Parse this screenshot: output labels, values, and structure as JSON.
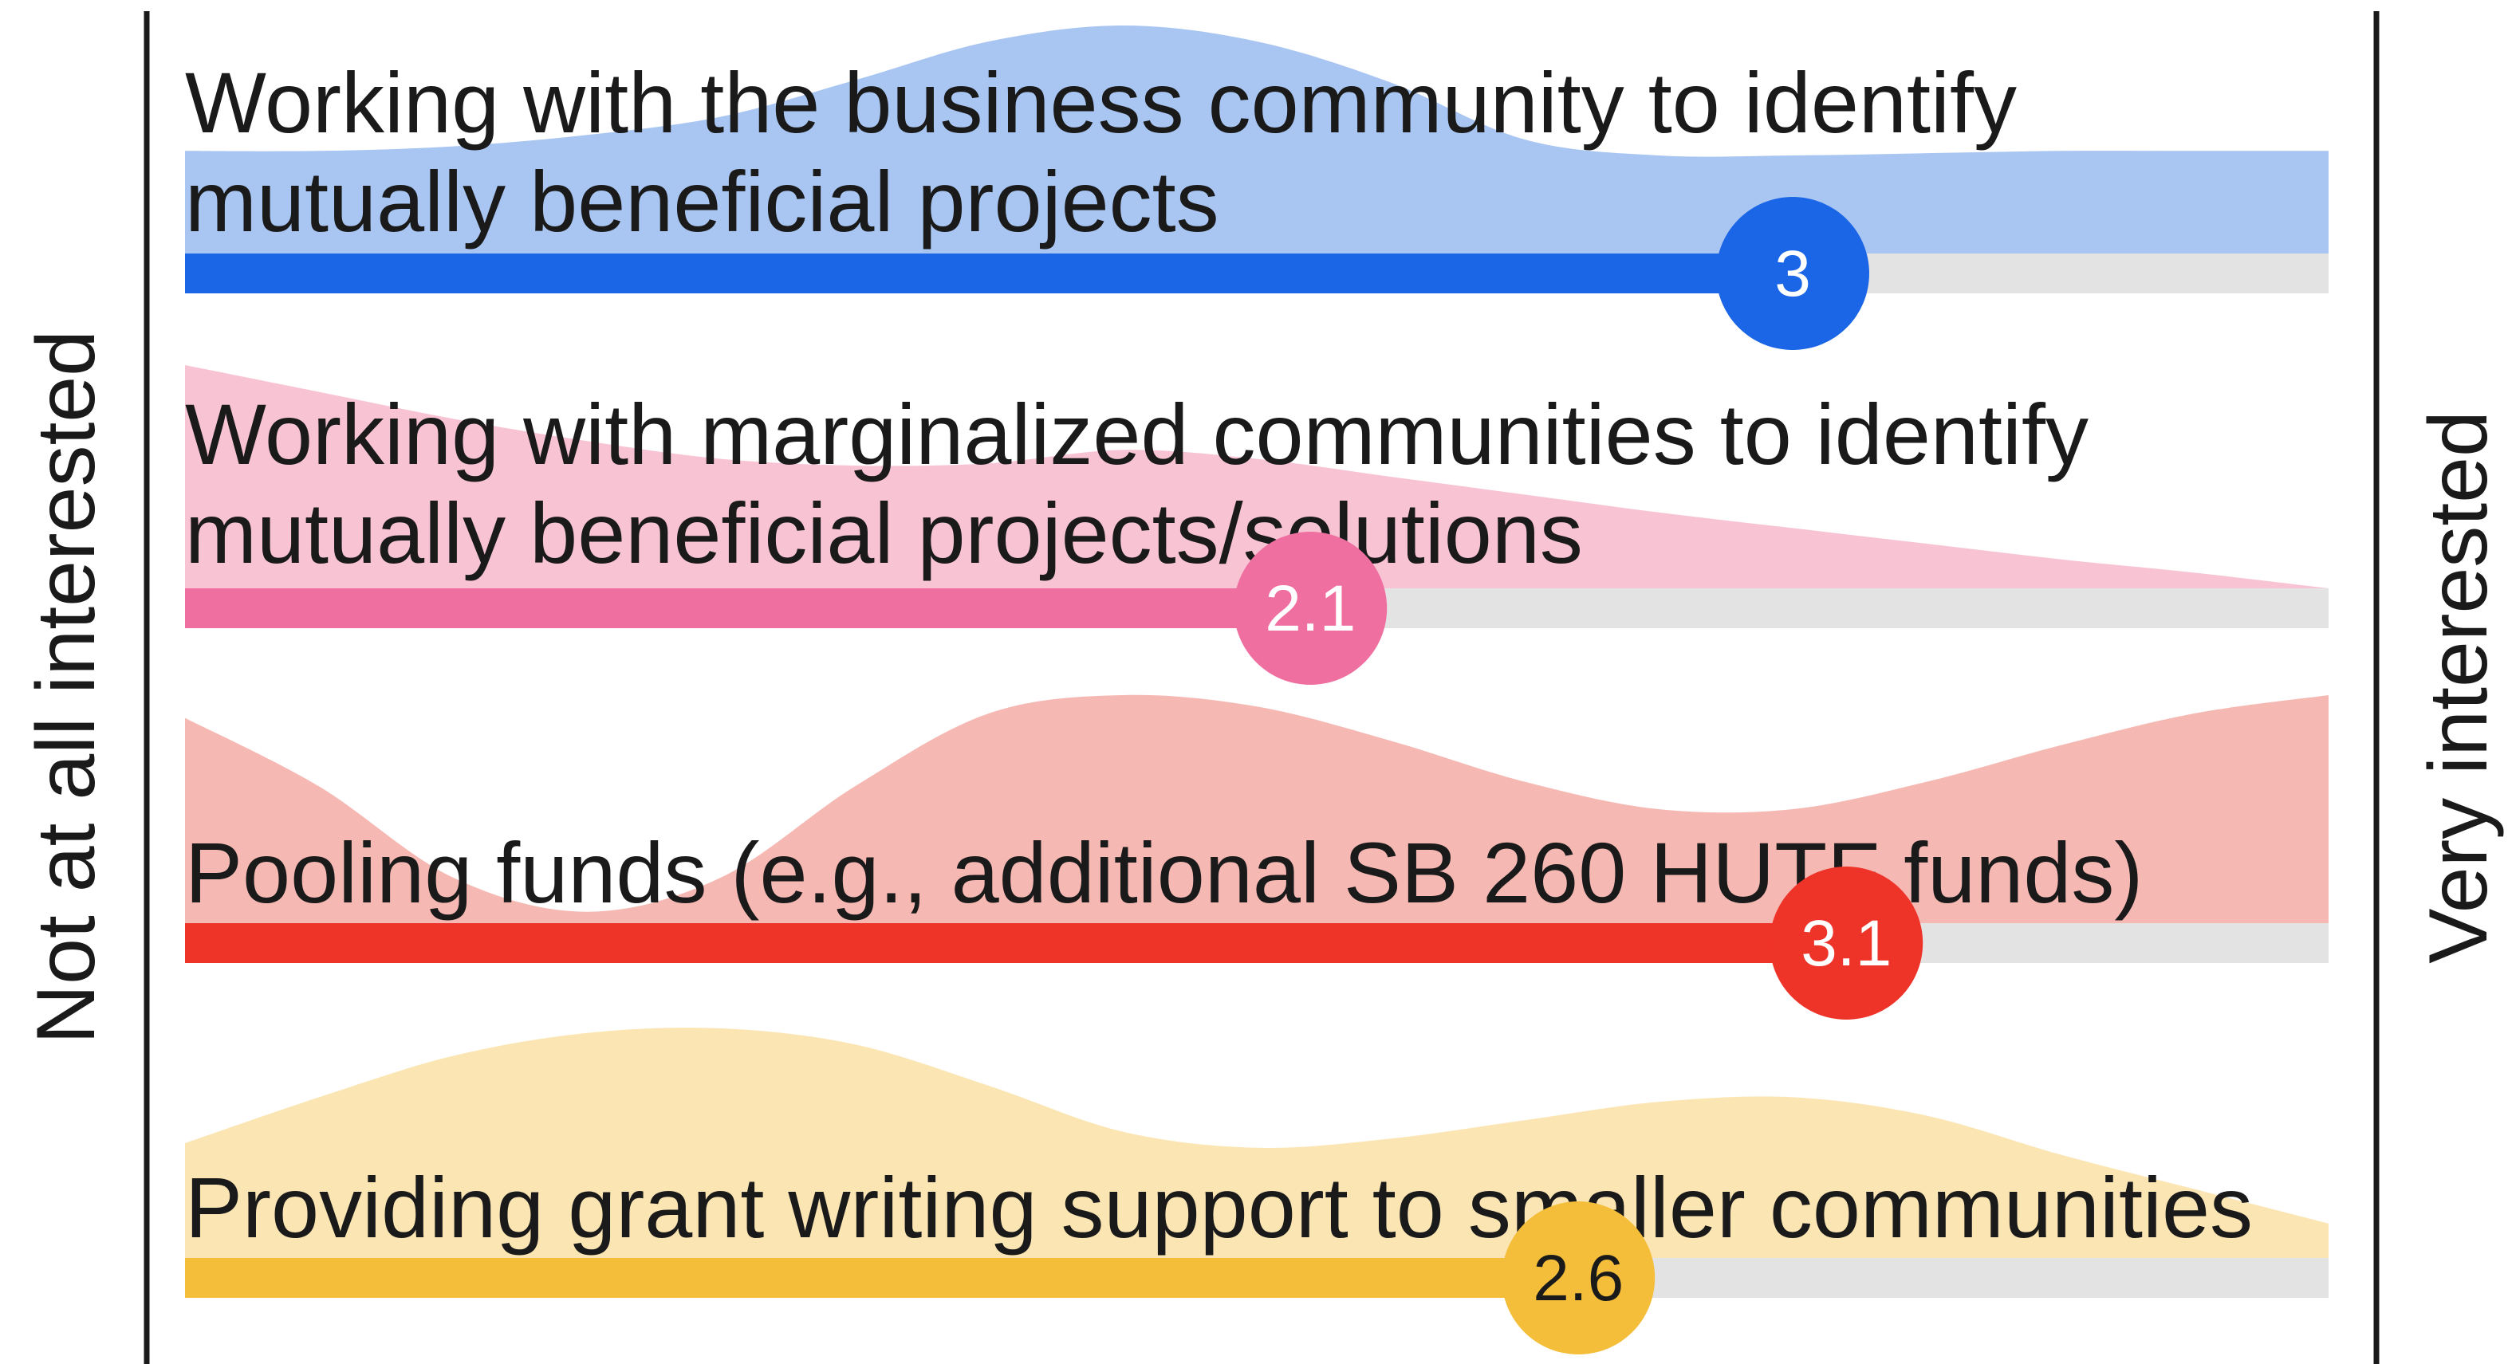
{
  "chart_data": {
    "type": "area",
    "title": "",
    "scale_min": 0,
    "scale_max": 4,
    "axis_left_label": "Not at all interested",
    "axis_right_label": "Very interested",
    "grid": false,
    "series": [
      {
        "name": "Working with the business community to identify mutually beneficial projects",
        "label_lines": [
          "Working with the business community to identify",
          "mutually beneficial projects"
        ],
        "average": 3,
        "average_label": "3",
        "color": "#1a66e6",
        "fill": "#a9c6f3",
        "badge_text_color": "#ffffff",
        "distribution": [
          0.45,
          0.45,
          0.47,
          0.52,
          0.6,
          0.76,
          0.93,
          1.0,
          0.93,
          0.75,
          0.5,
          0.43,
          0.43,
          0.44,
          0.45,
          0.45,
          0.45
        ]
      },
      {
        "name": "Working with marginalized communities to identify mutually beneficial projects/solutions",
        "label_lines": [
          "Working with marginalized communities to identify",
          "mutually beneficial projects/solutions"
        ],
        "average": 2.1,
        "average_label": "2.1",
        "color": "#ef6fa0",
        "fill": "#f8c4d4",
        "badge_text_color": "#ffffff",
        "distribution": [
          1.0,
          0.88,
          0.76,
          0.66,
          0.58,
          0.55,
          0.56,
          0.62,
          0.58,
          0.5,
          0.42,
          0.34,
          0.27,
          0.2,
          0.13,
          0.07,
          0.0
        ]
      },
      {
        "name": "Pooling funds (e.g., additional SB 260 HUTF funds)",
        "label_lines": [
          "Pooling funds (e.g., additional SB 260 HUTF funds)"
        ],
        "average": 3.1,
        "average_label": "3.1",
        "color": "#ee3328",
        "fill": "#f6b8b3",
        "badge_text_color": "#ffffff",
        "distribution": [
          0.9,
          0.6,
          0.2,
          0.05,
          0.2,
          0.6,
          0.92,
          1.0,
          0.95,
          0.8,
          0.62,
          0.5,
          0.5,
          0.62,
          0.78,
          0.92,
          1.0
        ]
      },
      {
        "name": "Providing grant writing support to smaller communities",
        "label_lines": [
          "Providing grant writing support to smaller communities"
        ],
        "average": 2.6,
        "average_label": "2.6",
        "color": "#f4be3a",
        "fill": "#fbe5b3",
        "badge_text_color": "#1a1a1a",
        "distribution": [
          0.5,
          0.7,
          0.88,
          0.98,
          1.0,
          0.93,
          0.75,
          0.55,
          0.48,
          0.52,
          0.6,
          0.68,
          0.7,
          0.62,
          0.45,
          0.3,
          0.15
        ]
      }
    ]
  }
}
